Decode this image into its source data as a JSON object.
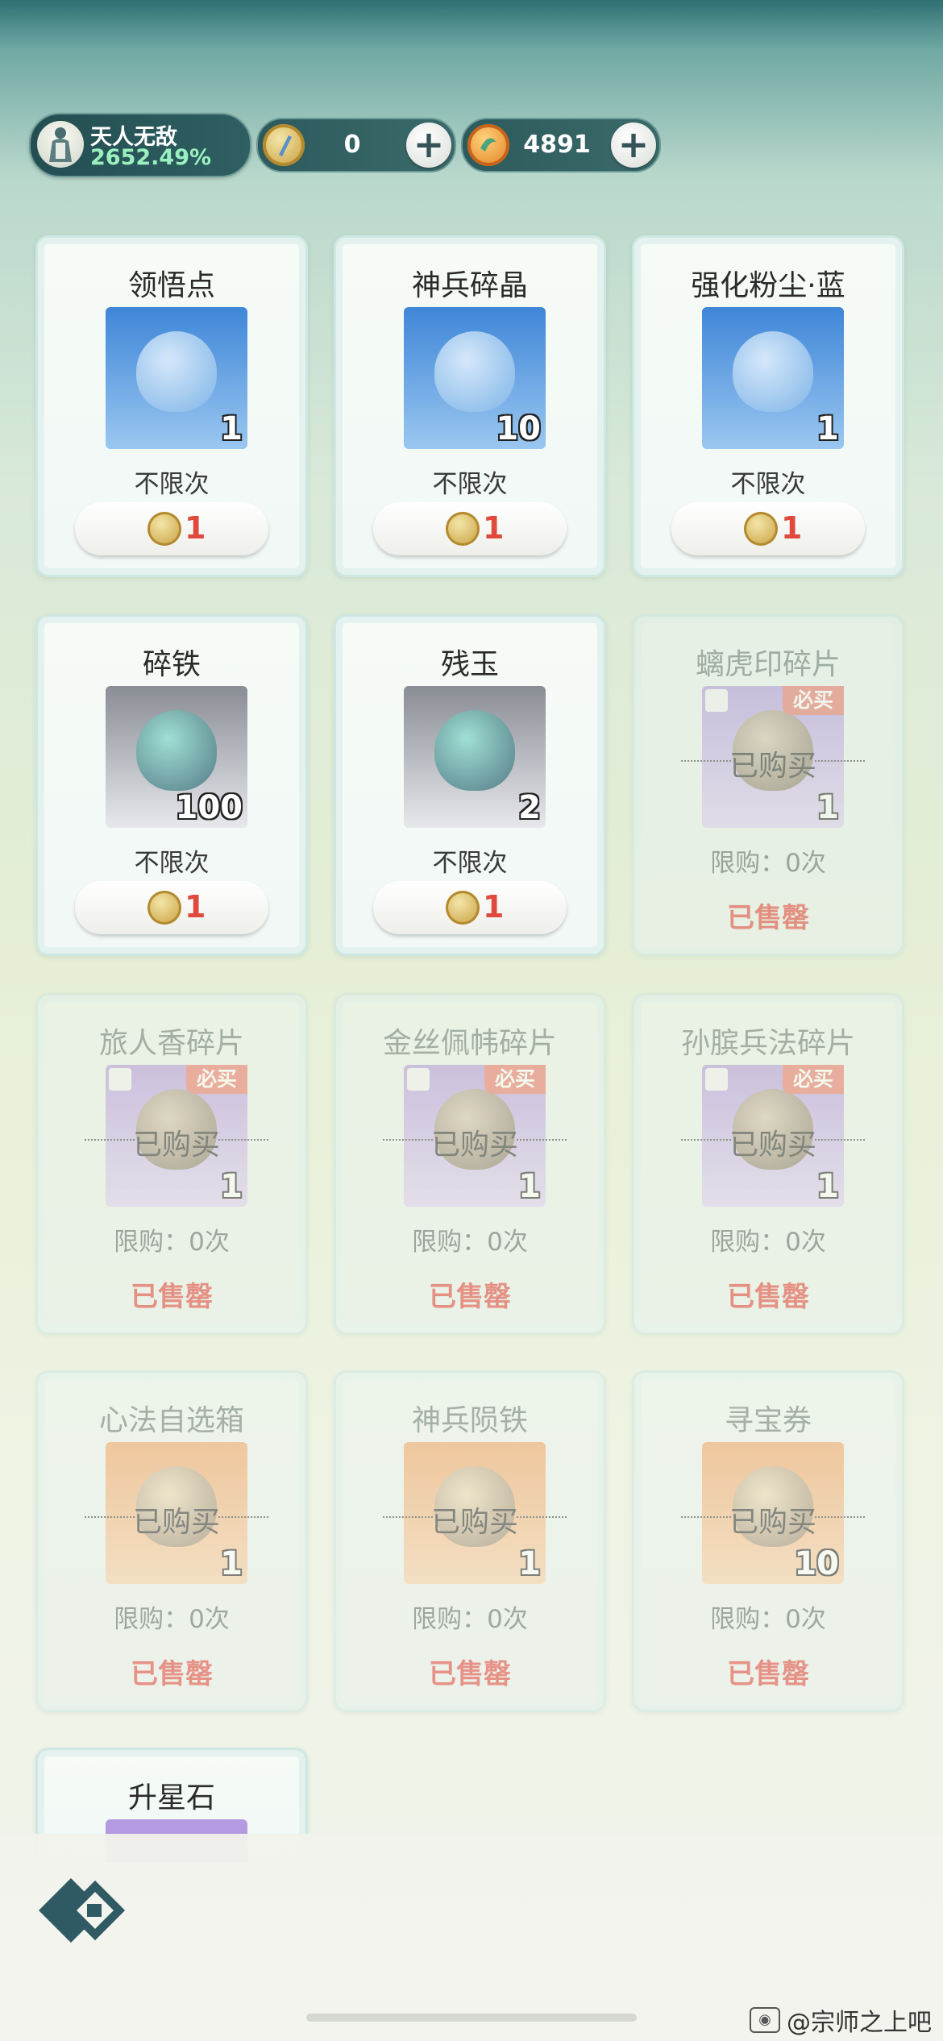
{
  "header": {
    "player_name": "天人无敌",
    "player_percent": "2652.49%",
    "currency1_value": "0",
    "currency2_value": "4891",
    "plus_label": "+"
  },
  "items": [
    {
      "title": "领悟点",
      "qty": "1",
      "limit": "不限次",
      "price": "1",
      "bg": "blue"
    },
    {
      "title": "神兵碎晶",
      "qty": "10",
      "limit": "不限次",
      "price": "1",
      "bg": "blue"
    },
    {
      "title": "强化粉尘·蓝",
      "qty": "1",
      "limit": "不限次",
      "price": "1",
      "bg": "blue"
    },
    {
      "title": "碎铁",
      "qty": "100",
      "limit": "不限次",
      "price": "1",
      "bg": "gray"
    },
    {
      "title": "残玉",
      "qty": "2",
      "limit": "不限次",
      "price": "1",
      "bg": "gray"
    },
    {
      "title": "螭虎印碎片",
      "qty": "1",
      "limit": "限购：0次",
      "status": "已售罄",
      "badge": "必买",
      "bought": "已购买",
      "bg": "purple"
    },
    {
      "title": "旅人香碎片",
      "qty": "1",
      "limit": "限购：0次",
      "status": "已售罄",
      "badge": "必买",
      "bought": "已购买",
      "bg": "purple"
    },
    {
      "title": "金丝佩帏碎片",
      "qty": "1",
      "limit": "限购：0次",
      "status": "已售罄",
      "badge": "必买",
      "bought": "已购买",
      "bg": "purple"
    },
    {
      "title": "孙膑兵法碎片",
      "qty": "1",
      "limit": "限购：0次",
      "status": "已售罄",
      "badge": "必买",
      "bought": "已购买",
      "bg": "purple"
    },
    {
      "title": "心法自选箱",
      "qty": "1",
      "limit": "限购：0次",
      "status": "已售罄",
      "bought": "已购买",
      "bg": "orange"
    },
    {
      "title": "神兵陨铁",
      "qty": "1",
      "limit": "限购：0次",
      "status": "已售罄",
      "bought": "已购买",
      "bg": "orange"
    },
    {
      "title": "寻宝券",
      "qty": "10",
      "limit": "限购：0次",
      "status": "已售罄",
      "bought": "已购买",
      "bg": "orange"
    },
    {
      "title": "升星石"
    }
  ],
  "watermark": "@宗师之上吧",
  "colors": {
    "price_red": "#e04a3c",
    "soldout_red": "#e0433a",
    "badge": "#e8776d"
  }
}
